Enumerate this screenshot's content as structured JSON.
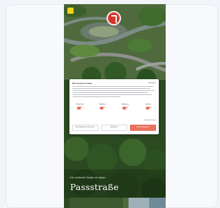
{
  "page": {
    "hero_subtitle": "Die schönste Straße der Alpen",
    "hero_title": "Passstraße"
  },
  "consent": {
    "title": "Wir benutzen Cookies",
    "badge": "Sprache",
    "options": [
      {
        "label": "Notwendig",
        "enabled": true
      },
      {
        "label": "Statistiken",
        "enabled": true
      },
      {
        "label": "Marketing",
        "enabled": true
      },
      {
        "label": "Externe",
        "enabled": true
      }
    ],
    "details_link": "Details anzeigen",
    "buttons": {
      "settings": "Einstellungen speichern",
      "deny": "Ablehnen",
      "accept": "Alle akzeptieren"
    }
  },
  "colors": {
    "accent": "#e8705d",
    "logo": "#f2d21a",
    "flag": "#d8372f"
  },
  "icons": {
    "logo": "brand-logo-icon",
    "flag": "location-badge-icon",
    "toggle": "toggle-on-icon"
  }
}
